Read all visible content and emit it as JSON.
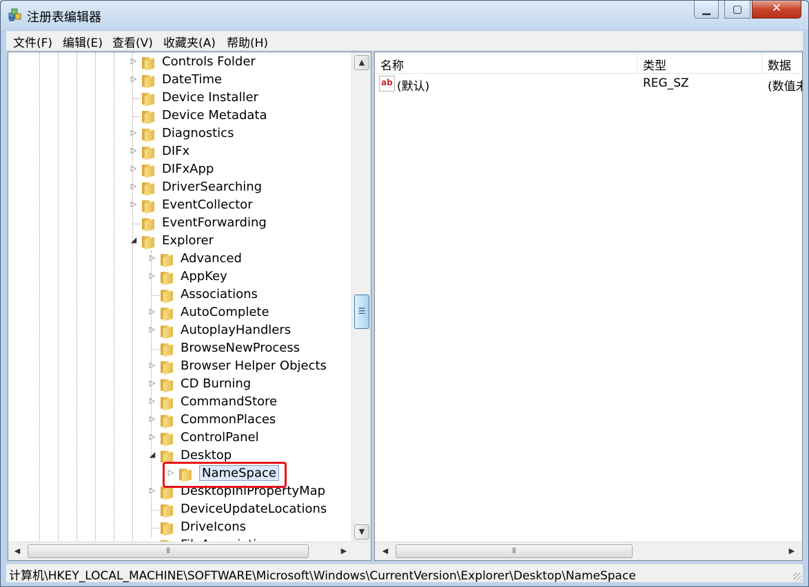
{
  "window": {
    "title": "注册表编辑器"
  },
  "menu": [
    "文件(F)",
    "编辑(E)",
    "查看(V)",
    "收藏夹(A)",
    "帮助(H)"
  ],
  "tree": [
    {
      "label": "Controls Folder",
      "level": 0,
      "expander": "collapsed"
    },
    {
      "label": "DateTime",
      "level": 0,
      "expander": "collapsed"
    },
    {
      "label": "Device Installer",
      "level": 0,
      "expander": "none"
    },
    {
      "label": "Device Metadata",
      "level": 0,
      "expander": "none"
    },
    {
      "label": "Diagnostics",
      "level": 0,
      "expander": "collapsed"
    },
    {
      "label": "DIFx",
      "level": 0,
      "expander": "collapsed"
    },
    {
      "label": "DIFxApp",
      "level": 0,
      "expander": "collapsed"
    },
    {
      "label": "DriverSearching",
      "level": 0,
      "expander": "collapsed"
    },
    {
      "label": "EventCollector",
      "level": 0,
      "expander": "collapsed"
    },
    {
      "label": "EventForwarding",
      "level": 0,
      "expander": "none"
    },
    {
      "label": "Explorer",
      "level": 0,
      "expander": "expanded"
    },
    {
      "label": "Advanced",
      "level": 1,
      "expander": "collapsed"
    },
    {
      "label": "AppKey",
      "level": 1,
      "expander": "collapsed"
    },
    {
      "label": "Associations",
      "level": 1,
      "expander": "none"
    },
    {
      "label": "AutoComplete",
      "level": 1,
      "expander": "collapsed"
    },
    {
      "label": "AutoplayHandlers",
      "level": 1,
      "expander": "collapsed"
    },
    {
      "label": "BrowseNewProcess",
      "level": 1,
      "expander": "none"
    },
    {
      "label": "Browser Helper Objects",
      "level": 1,
      "expander": "collapsed"
    },
    {
      "label": "CD Burning",
      "level": 1,
      "expander": "collapsed"
    },
    {
      "label": "CommandStore",
      "level": 1,
      "expander": "collapsed"
    },
    {
      "label": "CommonPlaces",
      "level": 1,
      "expander": "collapsed"
    },
    {
      "label": "ControlPanel",
      "level": 1,
      "expander": "collapsed"
    },
    {
      "label": "Desktop",
      "level": 1,
      "expander": "expanded"
    },
    {
      "label": "NameSpace",
      "level": 2,
      "expander": "collapsed",
      "selected": true
    },
    {
      "label": "DesktopIniPropertyMap",
      "level": 1,
      "expander": "collapsed"
    },
    {
      "label": "DeviceUpdateLocations",
      "level": 1,
      "expander": "none"
    },
    {
      "label": "DriveIcons",
      "level": 1,
      "expander": "none"
    },
    {
      "label": "FileAssociation",
      "level": 1,
      "expander": "none"
    }
  ],
  "list": {
    "columns": [
      "名称",
      "类型",
      "数据"
    ],
    "rows": [
      {
        "name": "(默认)",
        "type": "REG_SZ",
        "data": "(数值未"
      }
    ]
  },
  "statusbar": {
    "path": "计算机\\HKEY_LOCAL_MACHINE\\SOFTWARE\\Microsoft\\Windows\\CurrentVersion\\Explorer\\Desktop\\NameSpace"
  },
  "icons": {
    "app": "registry-editor-icon",
    "folder": "folder-icon",
    "value": "string-value-icon"
  },
  "colors": {
    "highlight_box": "#e8121a",
    "selection": "#dbe9fb"
  }
}
